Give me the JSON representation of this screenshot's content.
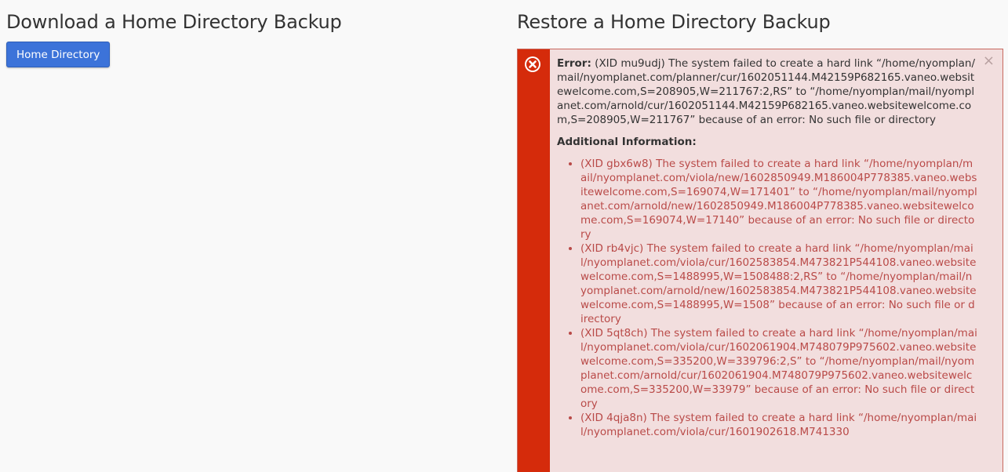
{
  "download": {
    "title": "Download a Home Directory Backup",
    "button_label": "Home Directory"
  },
  "restore": {
    "title": "Restore a Home Directory Backup",
    "alert": {
      "error_label": "Error:",
      "error_message": "(XID mu9udj) The system failed to create a hard link “/home/nyomplan/mail/nyomplanet.com/planner/cur/1602051144.M42159P682165.vaneo.websitewelcome.com,S=208905,W=211767:2,RS” to “/home/nyomplan/mail/nyomplanet.com/arnold/cur/1602051144.M42159P682165.vaneo.websitewelcome.com,S=208905,W=211767” because of an error: No such file or directory",
      "additional_title": "Additional Information:",
      "close_glyph": "×",
      "colors": {
        "stripe": "#d52b0b",
        "background": "#f2dede",
        "list_text": "#b94a48"
      },
      "items": [
        "(XID gbx6w8) The system failed to create a hard link “/home/nyomplan/mail/nyomplanet.com/viola/new/1602850949.M186004P778385.vaneo.websitewelcome.com,S=169074,W=171401” to “/home/nyomplan/mail/nyomplanet.com/arnold/new/1602850949.M186004P778385.vaneo.websitewelcome.com,S=169074,W=17140” because of an error: No such file or directory",
        "(XID rb4vjc) The system failed to create a hard link “/home/nyomplan/mail/nyomplanet.com/viola/cur/1602583854.M473821P544108.vaneo.websitewelcome.com,S=1488995,W=1508488:2,RS” to “/home/nyomplan/mail/nyomplanet.com/arnold/new/1602583854.M473821P544108.vaneo.websitewelcome.com,S=1488995,W=1508” because of an error: No such file or directory",
        "(XID 5qt8ch) The system failed to create a hard link “/home/nyomplan/mail/nyomplanet.com/viola/cur/1602061904.M748079P975602.vaneo.websitewelcome.com,S=335200,W=339796:2,S” to “/home/nyomplan/mail/nyomplanet.com/arnold/cur/1602061904.M748079P975602.vaneo.websitewelcome.com,S=335200,W=33979” because of an error: No such file or directory",
        "(XID 4qja8n) The system failed to create a hard link “/home/nyomplan/mail/nyomplanet.com/viola/cur/1601902618.M741330"
      ]
    }
  }
}
